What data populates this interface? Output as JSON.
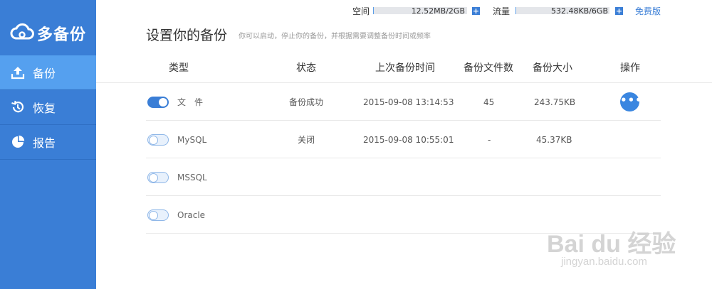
{
  "app": {
    "logo_text": "多备份"
  },
  "sidebar": {
    "items": [
      {
        "label": "备份",
        "icon": "upload-icon",
        "active": true
      },
      {
        "label": "恢复",
        "icon": "history-icon",
        "active": false
      },
      {
        "label": "报告",
        "icon": "pie-chart-icon",
        "active": false
      }
    ]
  },
  "topbar": {
    "space_label": "空间",
    "space_value": "12.52MB/2GB",
    "space_used_percent": 0.6,
    "traffic_label": "流量",
    "traffic_value": "532.48KB/6GB",
    "traffic_used_percent": 0.01,
    "free_link": "免费版"
  },
  "header": {
    "title": "设置你的备份",
    "subtitle": "你可以启动，停止你的备份，并根据需要调整备份时间或频率"
  },
  "table": {
    "columns": [
      "类型",
      "状态",
      "上次备份时间",
      "备份文件数",
      "备份大小",
      "操作"
    ],
    "rows": [
      {
        "type": "文　件",
        "enabled": true,
        "status": "备份成功",
        "last_backup": "2015-09-08 13:14:53",
        "file_count": "45",
        "size": "243.75KB",
        "has_action": true
      },
      {
        "type": "MySQL",
        "enabled": false,
        "status": "关闭",
        "last_backup": "2015-09-08 10:55:01",
        "file_count": "-",
        "size": "45.37KB",
        "has_action": false
      },
      {
        "type": "MSSQL",
        "enabled": false,
        "status": "",
        "last_backup": "",
        "file_count": "",
        "size": "",
        "has_action": false
      },
      {
        "type": "Oracle",
        "enabled": false,
        "status": "",
        "last_backup": "",
        "file_count": "",
        "size": "",
        "has_action": false
      }
    ],
    "action_symbol": "•••"
  },
  "watermark": {
    "main": "Bai du 经验",
    "sub": "jingyan.baidu.com"
  },
  "colors": {
    "sidebar_bg": "#3a7ed6",
    "sidebar_active": "#55a0ef",
    "accent": "#3a7ed6"
  }
}
